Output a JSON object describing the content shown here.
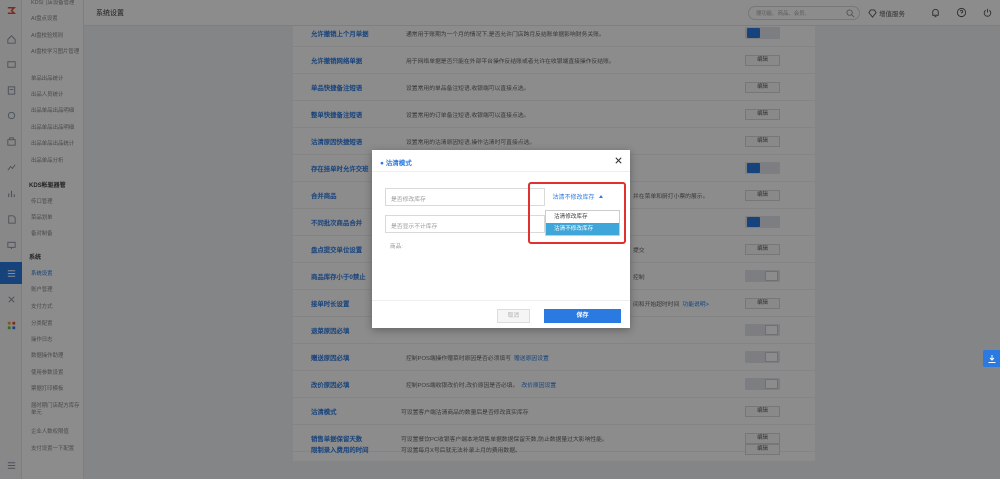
{
  "header": {
    "title": "系统设置",
    "search_placeholder": "搜功能、商品、会员、",
    "service_label": "增值服务"
  },
  "submenu": [
    {
      "label": "KDS门店设备管理",
      "type": "item"
    },
    {
      "label": "AI盘点设置",
      "type": "item"
    },
    {
      "label": "AI盘校验规则",
      "type": "item"
    },
    {
      "label": "AI盘校学习图片管理",
      "type": "item"
    },
    {
      "label": "单品出品统计",
      "type": "item"
    },
    {
      "label": "出品人员统计",
      "type": "item"
    },
    {
      "label": "出品单品出品明细",
      "type": "item"
    },
    {
      "label": "出品单品出品明细",
      "type": "item"
    },
    {
      "label": "出品单品出品统计",
      "type": "item"
    },
    {
      "label": "出品单品分析",
      "type": "item"
    },
    {
      "label": "KDS帐驱器管",
      "type": "head"
    },
    {
      "label": "传口管理",
      "type": "item"
    },
    {
      "label": "菜品划单",
      "type": "item"
    },
    {
      "label": "备对制备",
      "type": "item"
    },
    {
      "label": "系统",
      "type": "head"
    },
    {
      "label": "系统设置",
      "type": "active"
    },
    {
      "label": "账户管理",
      "type": "item"
    },
    {
      "label": "支付方式",
      "type": "item"
    },
    {
      "label": "分类配置",
      "type": "item"
    },
    {
      "label": "操作日志",
      "type": "item"
    },
    {
      "label": "数据操作助理",
      "type": "item"
    },
    {
      "label": "使用参数设置",
      "type": "item"
    },
    {
      "label": "票据打印模板",
      "type": "item"
    },
    {
      "label": "届时期门店配方库存单元",
      "type": "item"
    },
    {
      "label": "企业人数权限值",
      "type": "item"
    },
    {
      "label": "支付设置一下配置",
      "type": "item"
    }
  ],
  "settings": [
    {
      "name": "允许撤销上个月单据",
      "desc": "通常用于账期为一个月的情况下,是否允许门店跨月反结账单据影响财务关账。",
      "control": "toggle-on"
    },
    {
      "name": "允许撤销网络单据",
      "desc": "用于网络单据是否只能在外部平台操作反结账或者允许在收银端直接操作反结账。",
      "control": "edit"
    },
    {
      "name": "单品快捷备注短语",
      "desc": "设置常用的单品备注短语,收银端可以直接点选。",
      "control": "edit"
    },
    {
      "name": "整单快捷备注短语",
      "desc": "设置常用的订单备注短语,收银端可以直接点选。",
      "control": "edit"
    },
    {
      "name": "沽清原因快捷短语",
      "desc": "设置常用的沽清原因短语,操作沽清时可直接点选。",
      "control": "edit"
    },
    {
      "name": "存在挂单时允许交班",
      "desc": "",
      "control": "toggle-on"
    },
    {
      "name": "合并商品",
      "desc": "并在菜单和厨打小票的展示。",
      "control": "edit"
    },
    {
      "name": "不同批次商品合并",
      "desc": "",
      "control": "toggle-on"
    },
    {
      "name": "盘点提交单位设置",
      "desc": "提交",
      "control": "edit"
    },
    {
      "name": "商品库存小于0禁止",
      "desc": "控制",
      "control": "toggle-off"
    },
    {
      "name": "接单时长设置",
      "desc": "间和开始超时时间",
      "link": "功能说明>",
      "control": "edit"
    },
    {
      "name": "退菜原因必填",
      "desc": "",
      "control": "toggle-off"
    },
    {
      "name": "赠送原因必填",
      "desc": "控制POS端操作赠菜时原因是否必须填写",
      "link": "赠送原因设置",
      "control": "toggle-off"
    },
    {
      "name": "改价原因必填",
      "desc": "控制POS端收银改价时,改价原因是否必填。",
      "link": "改价原因设置",
      "control": "toggle-off"
    },
    {
      "name": "沽清模式",
      "desc": "可设置客户端沽清商品的数量后是否修改真实库存",
      "control": "edit"
    },
    {
      "name": "销售单据保留天数",
      "desc": "可设置餐饮PC收银客户端本地销售单据数据保留天数,防止数据量过大影响性能。",
      "control": "edit"
    },
    {
      "name": "限制录入费用的时间",
      "desc": "可设置每月X号后就无法补录上月的费用数据。",
      "control": "edit"
    }
  ],
  "edit_label": "编辑",
  "modal": {
    "title": "沽清模式",
    "field1_label": "是否修改库存",
    "field2_label": "是否显示不计库存",
    "goods_label": "商品:",
    "selected_value": "沽清不修改库存",
    "options": [
      "沽清修改库存",
      "沽清不修改库存"
    ],
    "cancel_label": "取消",
    "save_label": "保存"
  },
  "colors": {
    "accent": "#2a7ae2",
    "highlight_border": "#e03030",
    "dropdown_selected": "#3fa6d9"
  }
}
